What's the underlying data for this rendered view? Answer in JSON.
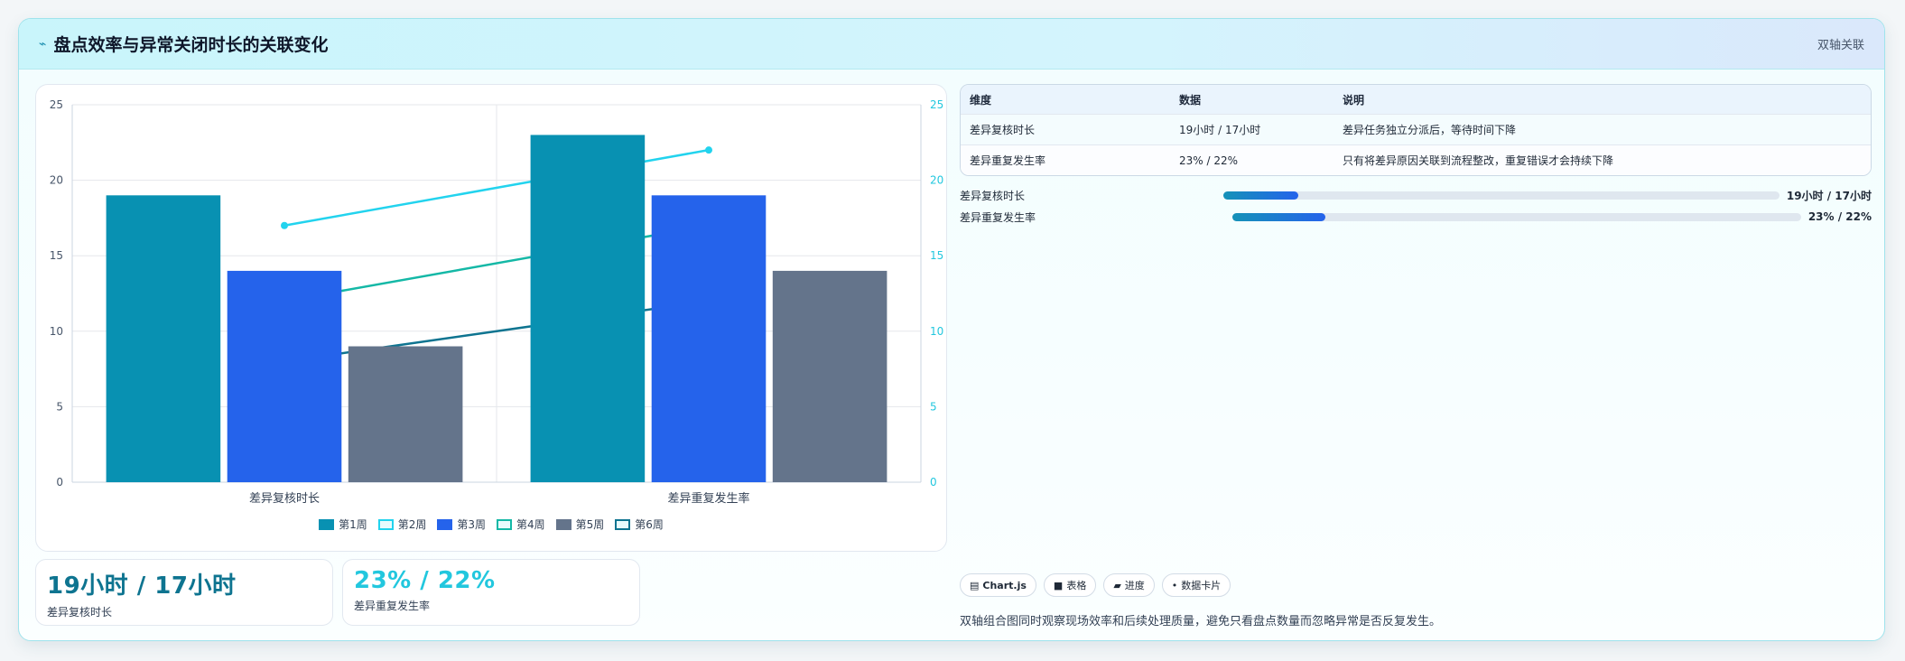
{
  "header": {
    "icon": "sparkline-icon",
    "title": "盘点效率与异常关闭时长的关联变化",
    "badge": "双轴关联"
  },
  "chart_data": {
    "type": "bar",
    "categories": [
      "差异复核时长",
      "差异重复发生率"
    ],
    "ylim": [
      0,
      25
    ],
    "y2lim": [
      0,
      25
    ],
    "yticks": [
      0,
      5,
      10,
      15,
      20,
      25
    ],
    "grid": true,
    "legend_position": "bottom",
    "bar_series": [
      {
        "name": "第1周",
        "values": [
          19,
          23
        ],
        "color": "#0891b2"
      },
      {
        "name": "第3周",
        "values": [
          14,
          19
        ],
        "color": "#2563eb"
      },
      {
        "name": "第5周",
        "values": [
          9,
          14
        ],
        "color": "#64748b"
      }
    ],
    "line_series": [
      {
        "name": "第2周",
        "values": [
          17,
          22
        ],
        "color": "#22d3ee"
      },
      {
        "name": "第4周",
        "values": [
          12,
          17
        ],
        "color": "#14b8a6"
      },
      {
        "name": "第6周",
        "values": [
          8,
          12
        ],
        "color": "#0e7490"
      }
    ],
    "legend_order": [
      "第1周",
      "第2周",
      "第3周",
      "第4周",
      "第5周",
      "第6周"
    ]
  },
  "stats": [
    {
      "value": "19小时 / 17小时",
      "label": "差异复核时长",
      "color": "#0e7490"
    },
    {
      "value": "23% / 22%",
      "label": "差异重复发生率",
      "color": "#22d3ee"
    }
  ],
  "table": {
    "headers": [
      "维度",
      "数据",
      "说明"
    ],
    "rows": [
      [
        "差异复核时长",
        "19小时 / 17小时",
        "差异任务独立分派后，等待时间下降"
      ],
      [
        "差异重复发生率",
        "23% / 22%",
        "只有将差异原因关联到流程整改，重复错误才会持续下降"
      ]
    ]
  },
  "progress": [
    {
      "label": "差异复核时长",
      "value": "19小时 / 17小时",
      "fraction": 0.135
    },
    {
      "label": "差异重复发生率",
      "value": "23% / 22%",
      "fraction": 0.163
    }
  ],
  "tags": [
    {
      "icon": "chart-icon",
      "glyph": "▤",
      "label": "Chart.js"
    },
    {
      "icon": "table-icon",
      "glyph": "■",
      "label": "表格"
    },
    {
      "icon": "progress-icon",
      "glyph": "▰",
      "label": "进度"
    },
    {
      "icon": "card-icon",
      "glyph": "•",
      "label": "数据卡片"
    }
  ],
  "note": "双轴组合图同时观察现场效率和后续处理质量，避免只看盘点数量而忽略异常是否反复发生。"
}
